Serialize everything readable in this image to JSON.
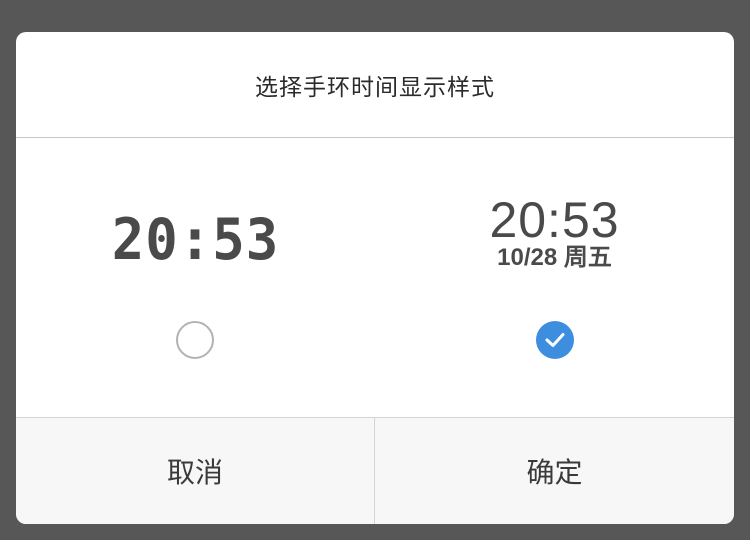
{
  "dialog": {
    "title": "选择手环时间显示样式"
  },
  "options": [
    {
      "style": "digital",
      "time": "20:53",
      "selected": false
    },
    {
      "style": "time-with-date",
      "time": "20:53",
      "date": "10/28 周五",
      "selected": true
    }
  ],
  "footer": {
    "cancel_label": "取消",
    "confirm_label": "确定"
  },
  "colors": {
    "accent": "#3e8ee0",
    "overlay": "#575757",
    "radio_off": "#b3b3b3"
  },
  "icons": {
    "selected": "checkmark-icon"
  }
}
